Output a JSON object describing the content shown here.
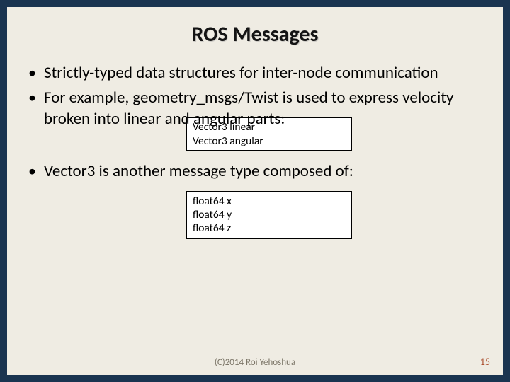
{
  "title": "ROS Messages",
  "bullets": {
    "b1": "Strictly-typed data structures for inter-node communication",
    "b2": "For example, geometry_msgs/Twist is used to express velocity broken into linear and angular parts:",
    "b3": "Vector3 is another message type composed of:"
  },
  "code1": {
    "line1": "Vector3 linear",
    "line2": "Vector3 angular"
  },
  "code2": {
    "line1": "float64 x",
    "line2": "float64 y",
    "line3": "float64 z"
  },
  "footer": "(C)2014 Roi Yehoshua",
  "page": "15"
}
